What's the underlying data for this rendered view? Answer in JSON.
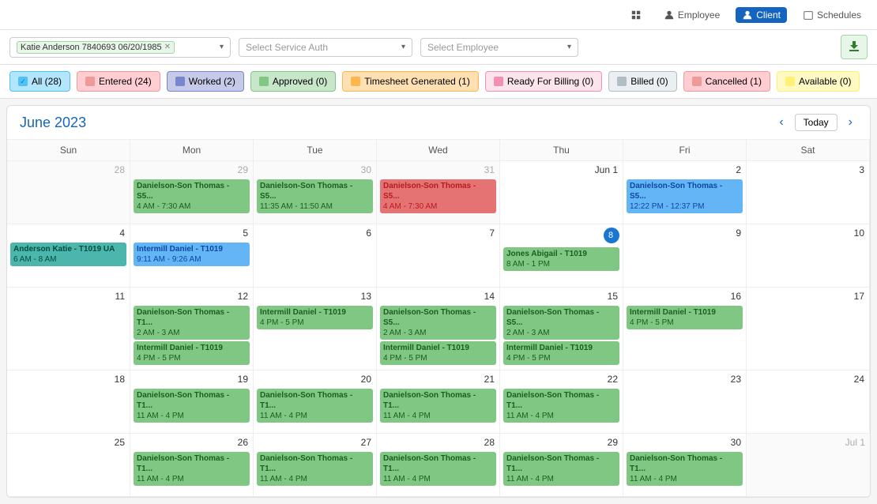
{
  "nav": {
    "employee_label": "Employee",
    "client_label": "Client",
    "schedules_label": "Schedules"
  },
  "filters": {
    "client_value": "Katie Anderson 7840693 06/20/1985",
    "service_auth_placeholder": "Select Service Auth",
    "employee_placeholder": "Select Employee",
    "download_title": "Download"
  },
  "status_buttons": [
    {
      "id": "all",
      "label": "All (28)",
      "color": "#4fc3f7",
      "active": true
    },
    {
      "id": "entered",
      "label": "Entered (24)",
      "color": "#ef9a9a",
      "active": false
    },
    {
      "id": "worked",
      "label": "Worked (2)",
      "color": "#7986cb",
      "active": false
    },
    {
      "id": "approved",
      "label": "Approved (0)",
      "color": "#81c784",
      "active": false
    },
    {
      "id": "timesheet_generated",
      "label": "Timesheet Generated (1)",
      "color": "#ffb74d",
      "active": false
    },
    {
      "id": "ready_for_billing",
      "label": "Ready For Billing (0)",
      "color": "#f48fb1",
      "active": false
    },
    {
      "id": "billed",
      "label": "Billed (0)",
      "color": "#b0bec5",
      "active": false
    },
    {
      "id": "cancelled",
      "label": "Cancelled (1)",
      "color": "#ef9a9a",
      "active": false
    },
    {
      "id": "available",
      "label": "Available (0)",
      "color": "#fff176",
      "active": false
    }
  ],
  "calendar": {
    "title": "June 2023",
    "today_label": "Today",
    "day_headers": [
      "Sun",
      "Mon",
      "Tue",
      "Wed",
      "Thu",
      "Fri",
      "Sat"
    ],
    "weeks": [
      {
        "days": [
          {
            "num": "28",
            "other": true,
            "events": []
          },
          {
            "num": "29",
            "other": true,
            "events": [
              {
                "text": "Danielson-Son Thomas - S5...",
                "sub": "4 AM - 7:30 AM",
                "color": "green"
              }
            ]
          },
          {
            "num": "30",
            "other": true,
            "events": [
              {
                "text": "Danielson-Son Thomas - S5...",
                "sub": "11:35 AM - 11:50 AM",
                "color": "green"
              }
            ]
          },
          {
            "num": "31",
            "other": true,
            "events": [
              {
                "text": "Danielson-Son Thomas - S5...",
                "sub": "4 AM - 7:30 AM",
                "color": "red"
              }
            ]
          },
          {
            "num": "Jun 1",
            "events": []
          },
          {
            "num": "2",
            "events": [
              {
                "text": "Danielson-Son Thomas - S5...",
                "sub": "12:22 PM - 12:37 PM",
                "color": "blue"
              }
            ]
          },
          {
            "num": "3",
            "other": false,
            "events": []
          }
        ]
      },
      {
        "days": [
          {
            "num": "4",
            "events": [
              {
                "text": "Anderson Katie - T1019 UA",
                "sub": "6 AM - 8 AM",
                "color": "teal"
              }
            ]
          },
          {
            "num": "5",
            "events": [
              {
                "text": "Intermill Daniel - T1019",
                "sub": "9:11 AM - 9:26 AM",
                "color": "blue"
              }
            ]
          },
          {
            "num": "6",
            "events": []
          },
          {
            "num": "7",
            "events": []
          },
          {
            "num": "8",
            "today": true,
            "events": [
              {
                "text": "Jones Abigail - T1019",
                "sub": "8 AM - 1 PM",
                "color": "green"
              }
            ]
          },
          {
            "num": "9",
            "events": []
          },
          {
            "num": "10",
            "events": []
          }
        ]
      },
      {
        "days": [
          {
            "num": "11",
            "events": []
          },
          {
            "num": "12",
            "events": [
              {
                "text": "Danielson-Son Thomas - T1...",
                "sub": "2 AM - 3 AM",
                "color": "green"
              },
              {
                "text": "Intermill Daniel - T1019",
                "sub": "4 PM - 5 PM",
                "color": "green"
              }
            ]
          },
          {
            "num": "13",
            "events": [
              {
                "text": "Intermill Daniel - T1019",
                "sub": "4 PM - 5 PM",
                "color": "green"
              }
            ]
          },
          {
            "num": "14",
            "events": [
              {
                "text": "Danielson-Son Thomas - S5...",
                "sub": "2 AM - 3 AM",
                "color": "green"
              },
              {
                "text": "Intermill Daniel - T1019",
                "sub": "4 PM - 5 PM",
                "color": "green"
              }
            ]
          },
          {
            "num": "15",
            "events": [
              {
                "text": "Danielson-Son Thomas - S5...",
                "sub": "2 AM - 3 AM",
                "color": "green"
              },
              {
                "text": "Intermill Daniel - T1019",
                "sub": "4 PM - 5 PM",
                "color": "green"
              }
            ]
          },
          {
            "num": "16",
            "events": [
              {
                "text": "Intermill Daniel - T1019",
                "sub": "4 PM - 5 PM",
                "color": "green"
              }
            ]
          },
          {
            "num": "17",
            "events": []
          }
        ]
      },
      {
        "days": [
          {
            "num": "18",
            "events": []
          },
          {
            "num": "19",
            "events": [
              {
                "text": "Danielson-Son Thomas - T1...",
                "sub": "11 AM - 4 PM",
                "color": "green"
              }
            ]
          },
          {
            "num": "20",
            "events": [
              {
                "text": "Danielson-Son Thomas - T1...",
                "sub": "11 AM - 4 PM",
                "color": "green"
              }
            ]
          },
          {
            "num": "21",
            "events": [
              {
                "text": "Danielson-Son Thomas - T1...",
                "sub": "11 AM - 4 PM",
                "color": "green"
              }
            ]
          },
          {
            "num": "22",
            "events": [
              {
                "text": "Danielson-Son Thomas - T1...",
                "sub": "11 AM - 4 PM",
                "color": "green"
              }
            ]
          },
          {
            "num": "23",
            "events": []
          },
          {
            "num": "24",
            "events": []
          }
        ]
      },
      {
        "days": [
          {
            "num": "25",
            "events": []
          },
          {
            "num": "26",
            "events": [
              {
                "text": "Danielson-Son Thomas - T1...",
                "sub": "11 AM - 4 PM",
                "color": "green"
              }
            ]
          },
          {
            "num": "27",
            "events": [
              {
                "text": "Danielson-Son Thomas - T1...",
                "sub": "11 AM - 4 PM",
                "color": "green"
              }
            ]
          },
          {
            "num": "28",
            "events": [
              {
                "text": "Danielson-Son Thomas - T1...",
                "sub": "11 AM - 4 PM",
                "color": "green"
              }
            ]
          },
          {
            "num": "29",
            "events": [
              {
                "text": "Danielson-Son Thomas - T1...",
                "sub": "11 AM - 4 PM",
                "color": "green"
              }
            ]
          },
          {
            "num": "30",
            "events": [
              {
                "text": "Danielson-Son Thomas - T1...",
                "sub": "11 AM - 4 PM",
                "color": "green"
              }
            ]
          },
          {
            "num": "Jul 1",
            "other": true,
            "events": []
          }
        ]
      }
    ]
  }
}
